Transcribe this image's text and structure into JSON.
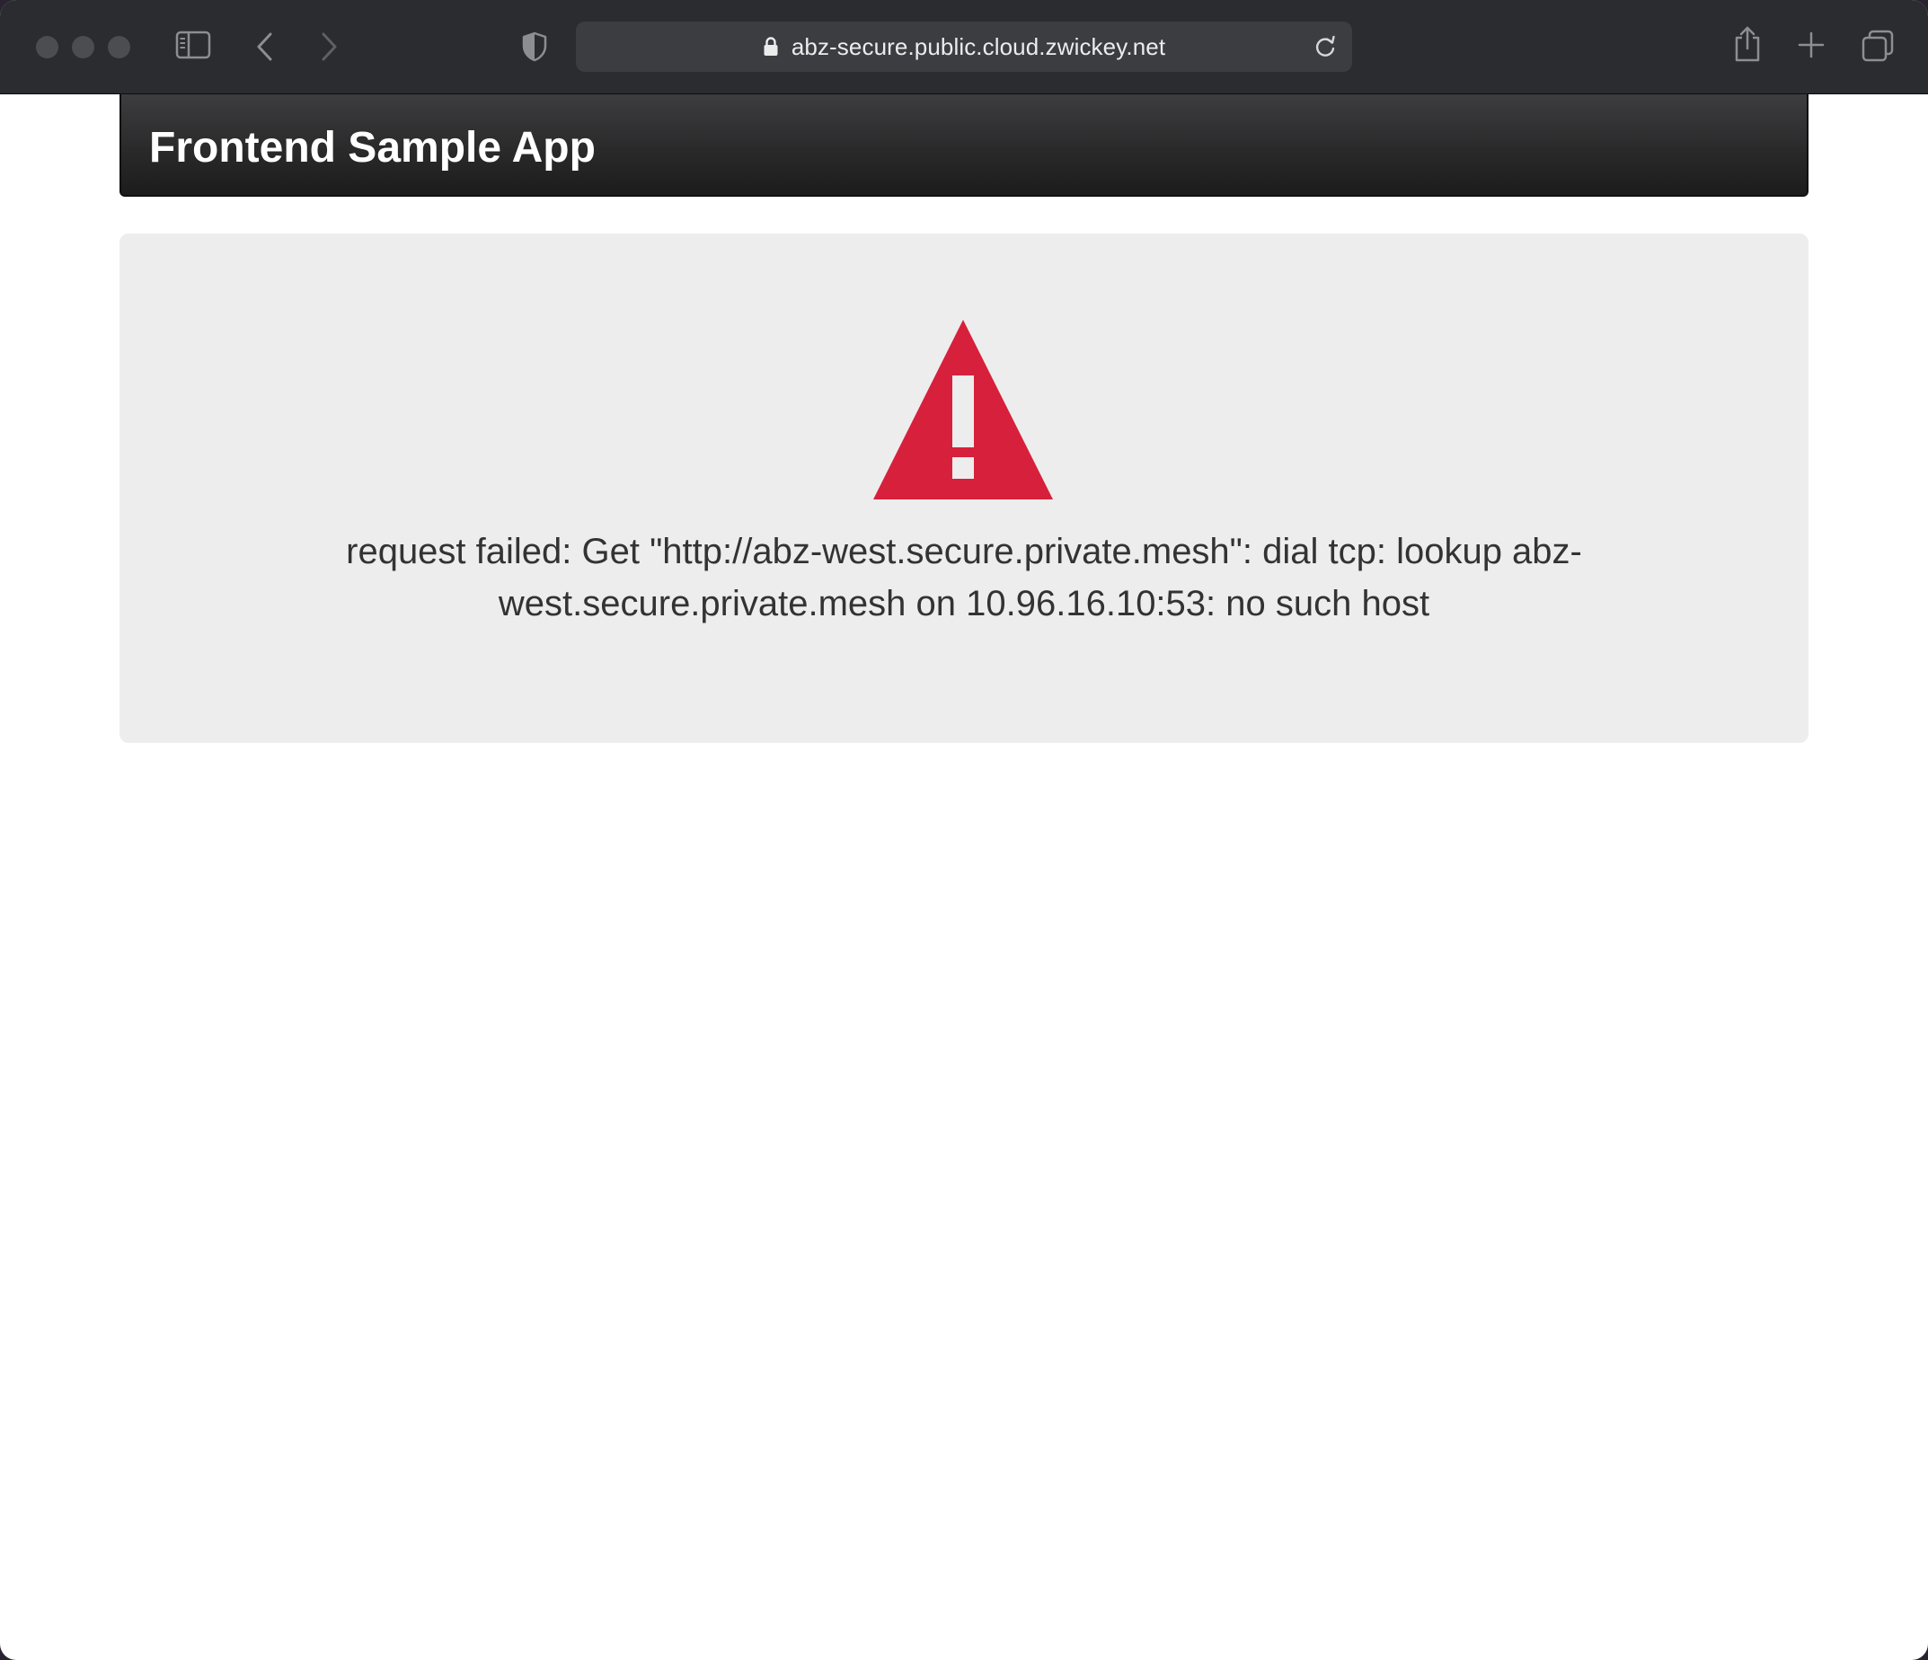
{
  "browser": {
    "url": "abz-secure.public.cloud.zwickey.net",
    "icons": {
      "close": "traffic-light-close",
      "minimize": "traffic-light-minimize",
      "zoom": "traffic-light-zoom",
      "sidebar": "sidebar-icon",
      "back": "chevron-left-icon",
      "forward": "chevron-right-icon",
      "privacy": "shield-icon",
      "lock": "lock-icon",
      "reload": "reload-icon",
      "share": "share-icon",
      "new_tab": "plus-icon",
      "tabs": "tabs-overview-icon"
    }
  },
  "app": {
    "brand": "Frontend Sample App"
  },
  "error": {
    "icon": "warning-triangle-icon",
    "message": "request failed: Get \"http://abz-west.secure.private.mesh\": dial tcp: lookup abz-west.secure.private.mesh on 10.96.16.10:53: no such host"
  },
  "colors": {
    "toolbar": "#2a2c2f",
    "address_bar": "#3b3d41",
    "navbar": "#222222",
    "panel": "#ededed",
    "warning": "#d7203b"
  }
}
